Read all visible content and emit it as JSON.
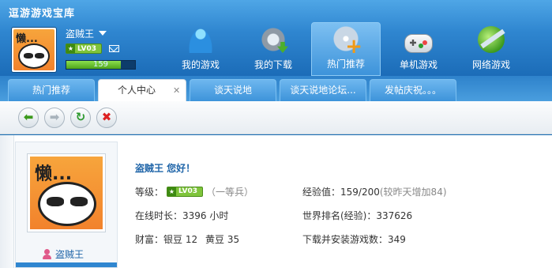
{
  "app": {
    "title": "逗游游戏宝库"
  },
  "user": {
    "name": "盗贼王",
    "level_badge": "LV03",
    "exp_value": "159",
    "exp_fraction": 0.795
  },
  "nav": [
    {
      "label": "我的游戏",
      "icon": "people-icon"
    },
    {
      "label": "我的下载",
      "icon": "gear-download-icon"
    },
    {
      "label": "热门推荐",
      "icon": "disc-plus-icon",
      "active": true
    },
    {
      "label": "单机游戏",
      "icon": "gamepad-icon"
    },
    {
      "label": "网络游戏",
      "icon": "globe-icon"
    }
  ],
  "tabs": [
    {
      "label": "热门推荐"
    },
    {
      "label": "个人中心",
      "active": true,
      "closable": true
    },
    {
      "label": "谈天说地"
    },
    {
      "label": "谈天说地论坛..."
    },
    {
      "label": "发帖庆祝。。。"
    }
  ],
  "toolbar": {
    "back": "back-icon",
    "forward": "forward-icon",
    "refresh": "refresh-icon",
    "stop": "stop-icon"
  },
  "profile": {
    "sidebar_name": "盗贼王",
    "greeting": "盗贼王  您好！",
    "level_label": "等级：",
    "level_badge": "LV03",
    "level_rank": "（一等兵）",
    "online_label": "在线时长：",
    "online_value": "3396 小时",
    "wealth_label": "财富：",
    "wealth_silver_label": "银豆",
    "wealth_silver_value": "12",
    "wealth_gold_label": "黄豆",
    "wealth_gold_value": "35",
    "exp_label": "经验值：",
    "exp_value": "159/200",
    "exp_note": "(较昨天增加84)",
    "rank_label": "世界排名(经验)：",
    "rank_value": "337626",
    "downloads_label": "下载并安装游戏数：",
    "downloads_value": "349"
  },
  "colors": {
    "header_blue": "#2f86d0",
    "link_blue": "#1e64a8",
    "level_green": "#7fc43b"
  }
}
